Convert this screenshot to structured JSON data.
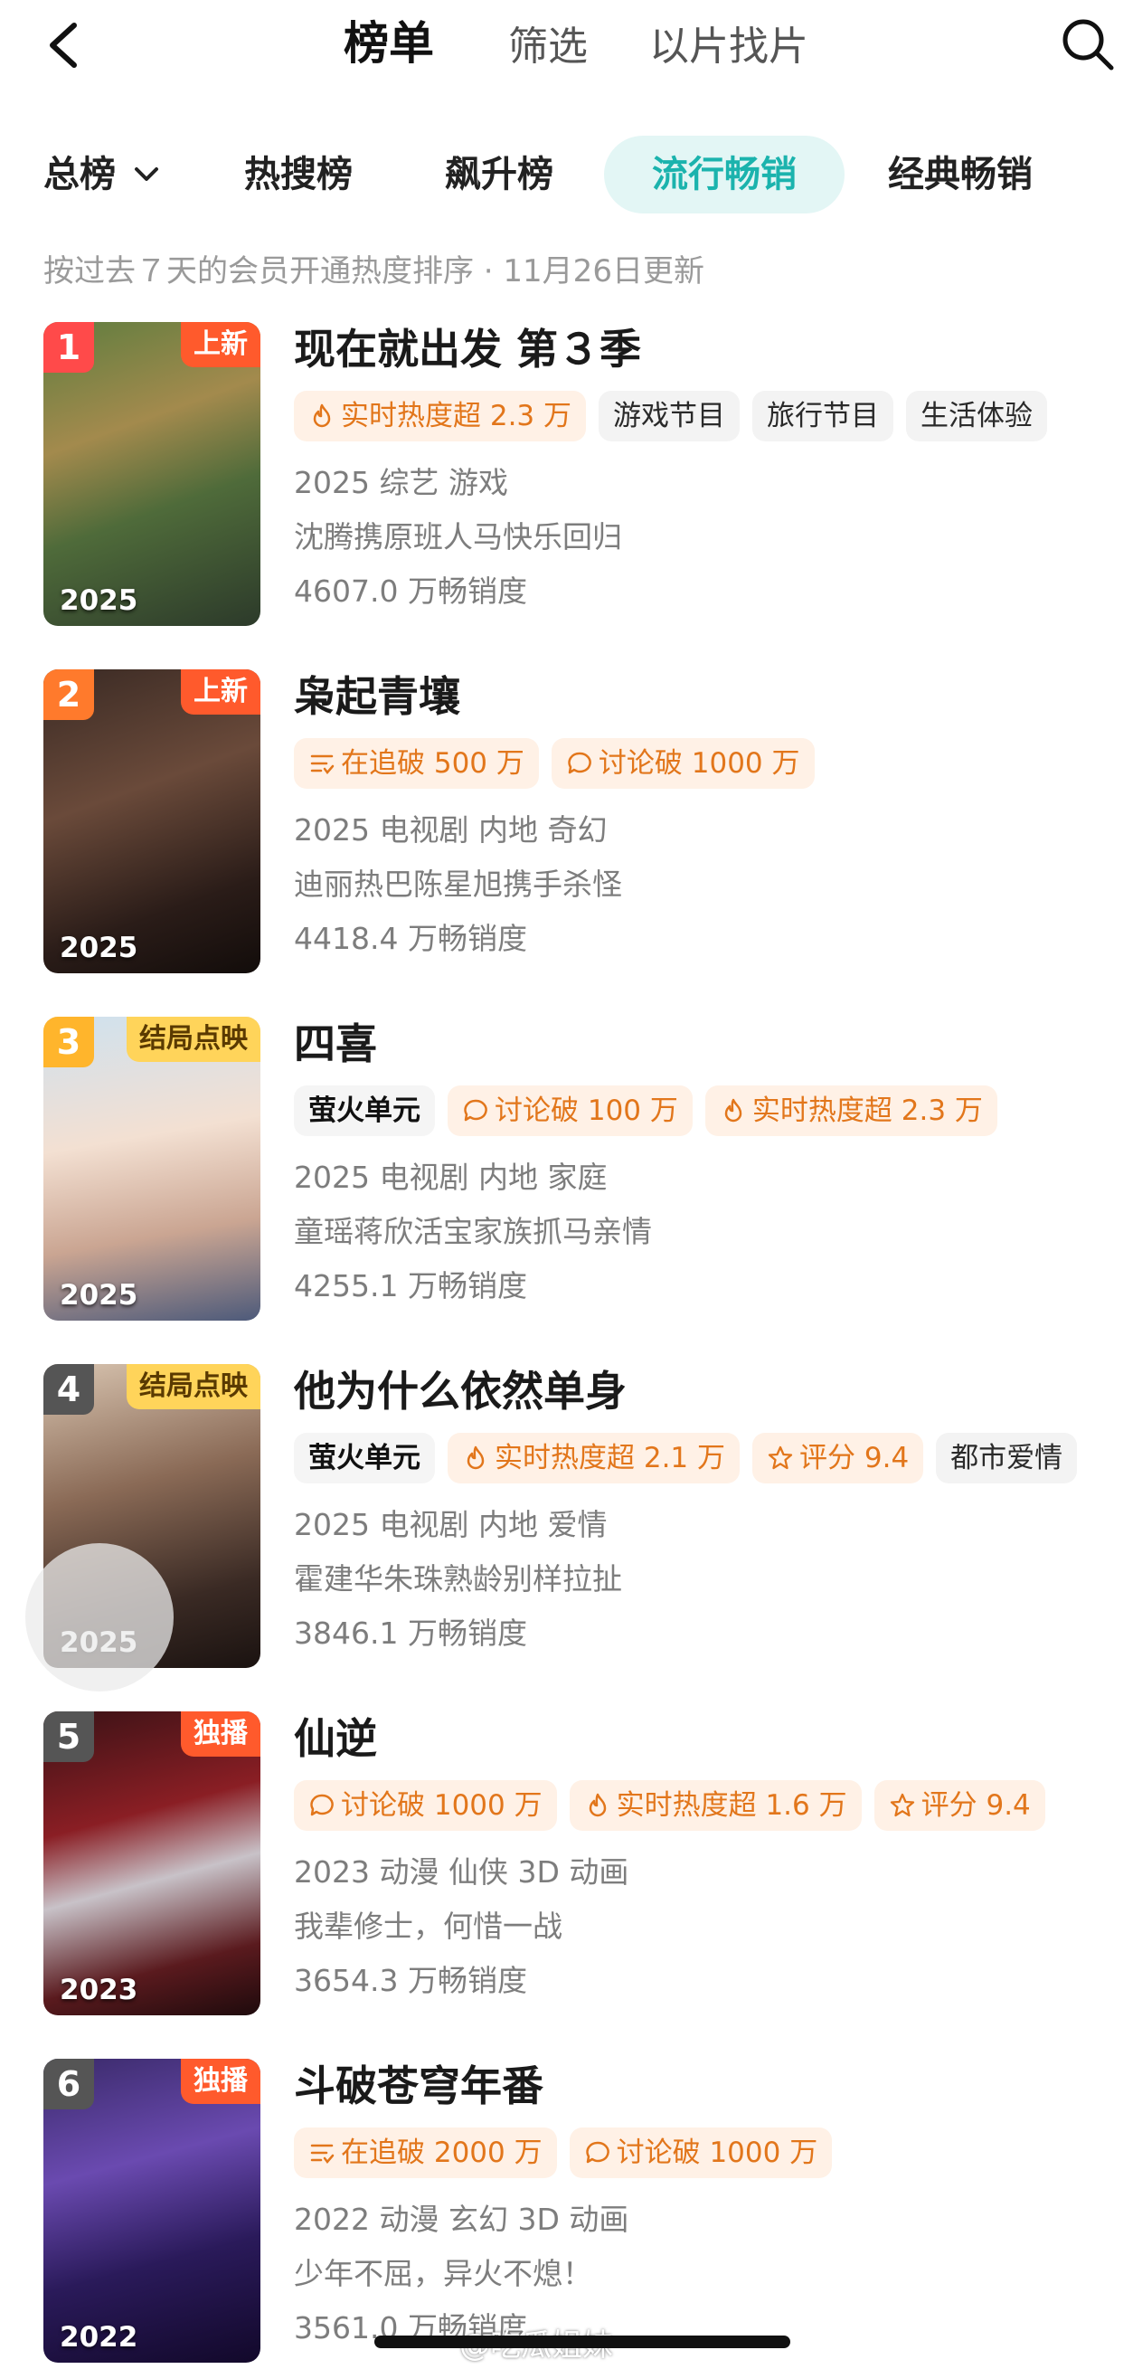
{
  "nav": {
    "tabs": [
      {
        "label": "榜单",
        "active": true
      },
      {
        "label": "筛选",
        "active": false
      },
      {
        "label": "以片找片",
        "active": false
      }
    ]
  },
  "categories": [
    {
      "label": "总榜",
      "active": false,
      "dropdown": true
    },
    {
      "label": "热搜榜",
      "active": false
    },
    {
      "label": "飙升榜",
      "active": false
    },
    {
      "label": "流行畅销",
      "active": true
    },
    {
      "label": "经典畅销",
      "active": false
    }
  ],
  "subtitle": "按过去７天的会员开通热度排序 · 11月26日更新",
  "accent_color": "#1bb3ad",
  "items": [
    {
      "rank": "1",
      "rank_color": "#ff4a4a",
      "badge": "上新",
      "badge_style": "red",
      "year": "2025",
      "title": "现在就出发 第３季",
      "tags": [
        {
          "icon": "flame-icon",
          "text": "实时热度超 2.3 万",
          "style": "hot"
        },
        {
          "text": "游戏节目",
          "style": "plain"
        },
        {
          "text": "旅行节目",
          "style": "plain"
        },
        {
          "text": "生活体验",
          "style": "plain"
        }
      ],
      "line1": "2025 综艺 游戏",
      "line2": "沈腾携原班人马快乐回归",
      "line3": "4607.0 万畅销度"
    },
    {
      "rank": "2",
      "rank_color": "#ff7a2c",
      "badge": "上新",
      "badge_style": "red",
      "year": "2025",
      "title": "枭起青壤",
      "tags": [
        {
          "icon": "list-icon",
          "text": "在追破 500 万",
          "style": "hot"
        },
        {
          "icon": "comment-icon",
          "text": "讨论破 1000 万",
          "style": "hot"
        }
      ],
      "line1": "2025 电视剧 内地 奇幻",
      "line2": "迪丽热巴陈星旭携手杀怪",
      "line3": "4418.4 万畅销度"
    },
    {
      "rank": "3",
      "rank_color": "#ffb52c",
      "badge": "结局点映",
      "badge_style": "yellow",
      "year": "2025",
      "title": "四喜",
      "tags": [
        {
          "text": "萤火单元",
          "style": "brand"
        },
        {
          "icon": "comment-icon",
          "text": "讨论破 100 万",
          "style": "hot"
        },
        {
          "icon": "flame-icon",
          "text": "实时热度超 2.3 万",
          "style": "hot"
        }
      ],
      "line1": "2025 电视剧 内地 家庭",
      "line2": "童瑶蒋欣活宝家族抓马亲情",
      "line3": "4255.1 万畅销度"
    },
    {
      "rank": "4",
      "rank_color": "#555555",
      "badge": "结局点映",
      "badge_style": "yellow",
      "year": "2025",
      "title": "他为什么依然单身",
      "tags": [
        {
          "text": "萤火单元",
          "style": "brand"
        },
        {
          "icon": "flame-icon",
          "text": "实时热度超 2.1 万",
          "style": "hot"
        },
        {
          "icon": "star-icon",
          "text": "评分 9.4",
          "style": "hot"
        },
        {
          "text": "都市爱情",
          "style": "plain"
        }
      ],
      "line1": "2025 电视剧 内地 爱情",
      "line2": "霍建华朱珠熟龄别样拉扯",
      "line3": "3846.1 万畅销度"
    },
    {
      "rank": "5",
      "rank_color": "#555555",
      "badge": "独播",
      "badge_style": "red",
      "year": "2023",
      "title": "仙逆",
      "tags": [
        {
          "icon": "comment-icon",
          "text": "讨论破 1000 万",
          "style": "hot"
        },
        {
          "icon": "flame-icon",
          "text": "实时热度超 1.6 万",
          "style": "hot"
        },
        {
          "icon": "star-icon",
          "text": "评分 9.4",
          "style": "hot"
        }
      ],
      "line1": "2023 动漫 仙侠 3D 动画",
      "line2": "我辈修士，何惜一战",
      "line3": "3654.3 万畅销度"
    },
    {
      "rank": "6",
      "rank_color": "#555555",
      "badge": "独播",
      "badge_style": "red",
      "year": "2022",
      "title": "斗破苍穹年番",
      "tags": [
        {
          "icon": "list-icon",
          "text": "在追破 2000 万",
          "style": "hot"
        },
        {
          "icon": "comment-icon",
          "text": "讨论破 1000 万",
          "style": "hot"
        }
      ],
      "line1": "2022 动漫 玄幻 3D 动画",
      "line2": "少年不屈，异火不熄！",
      "line3": "3561.0 万畅销度"
    }
  ],
  "watermark": "@吃瓜姐妹"
}
